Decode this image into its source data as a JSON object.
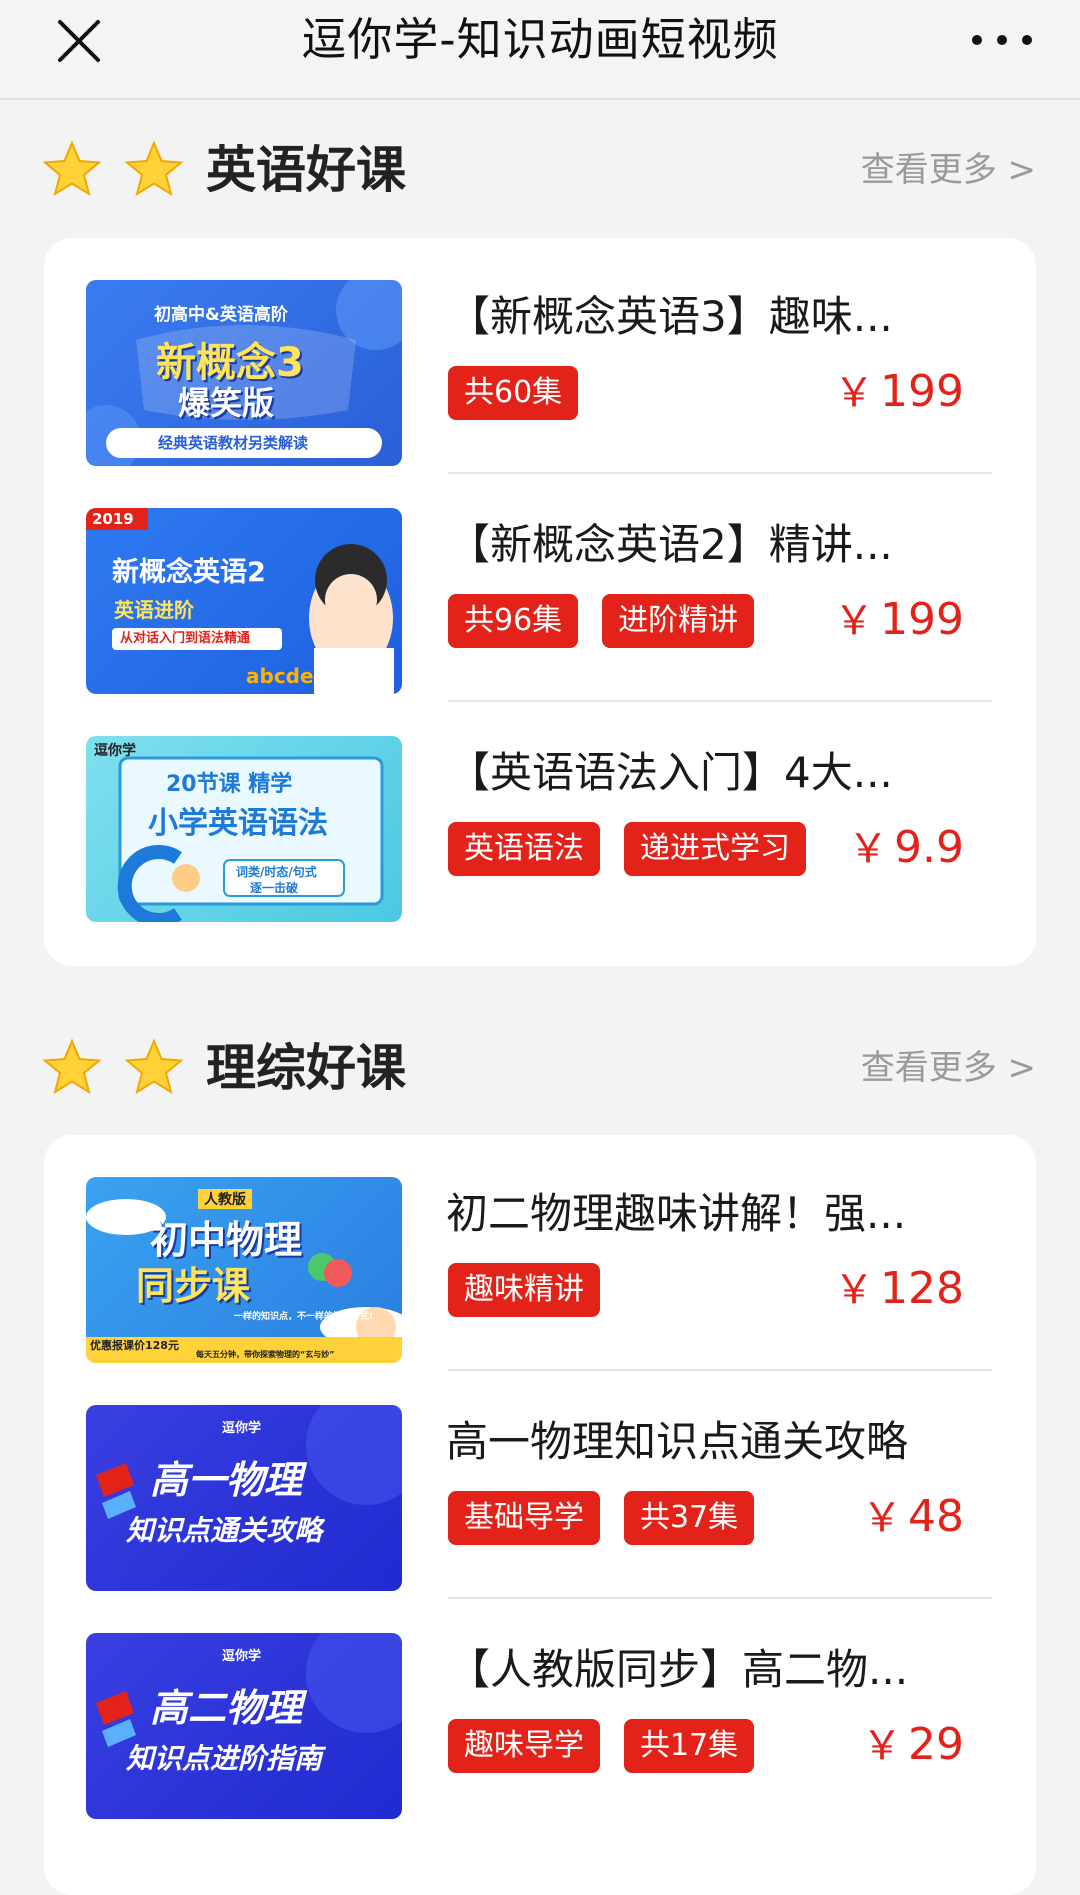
{
  "header": {
    "title": "逗你学-知识动画短视频"
  },
  "sections": [
    {
      "title": "英语好课",
      "see_more": "查看更多 >",
      "items": [
        {
          "title": "【新概念英语3】趣味...",
          "tags": [
            "共60集"
          ],
          "price": "199",
          "thumb": {
            "top": "初高中&英语高阶",
            "main1": "新概念3",
            "main2": "爆笑版",
            "bottom": "经典英语教材另类解读"
          }
        },
        {
          "title": "【新概念英语2】精讲...",
          "tags": [
            "共96集",
            "进阶精讲"
          ],
          "price": "199",
          "thumb": {
            "badge": "2019",
            "main1": "新概念英语2",
            "main2": "英语进阶",
            "bottom": "从对话入门到语法精通",
            "letters": "abcde"
          }
        },
        {
          "title": "【英语语法入门】4大...",
          "tags": [
            "英语语法",
            "递进式学习"
          ],
          "price": "9.9",
          "thumb": {
            "logo": "逗你学",
            "main1": "20节课 精学",
            "main2": "小学英语语法",
            "bottom1": "词类/时态/句式",
            "bottom2": "逐一击破"
          }
        }
      ]
    },
    {
      "title": "理综好课",
      "see_more": "查看更多 >",
      "items": [
        {
          "title": "初二物理趣味讲解！强...",
          "tags": [
            "趣味精讲"
          ],
          "price": "128",
          "thumb": {
            "badge": "人教版",
            "main1": "初中物理",
            "main2": "同步课",
            "slogan": "一样的知识点，不一样的授课方式!",
            "bottom1": "优惠报课价128元",
            "bottom2": "每天五分钟，带你探索物理的“玄与妙”"
          }
        },
        {
          "title": "高一物理知识点通关攻略",
          "tags": [
            "基础导学",
            "共37集"
          ],
          "price": "48",
          "thumb": {
            "logo": "逗你学",
            "main1": "高一物理",
            "main2": "知识点通关攻略"
          }
        },
        {
          "title": "【人教版同步】高二物...",
          "tags": [
            "趣味导学",
            "共17集"
          ],
          "price": "29",
          "thumb": {
            "logo": "逗你学",
            "main1": "高二物理",
            "main2": "知识点进阶指南"
          }
        }
      ]
    }
  ],
  "currency_symbol": "￥",
  "colors": {
    "accent_red": "#e3221a",
    "see_more_gray": "#9a9a9a",
    "page_bg": "#f3f3f3"
  }
}
